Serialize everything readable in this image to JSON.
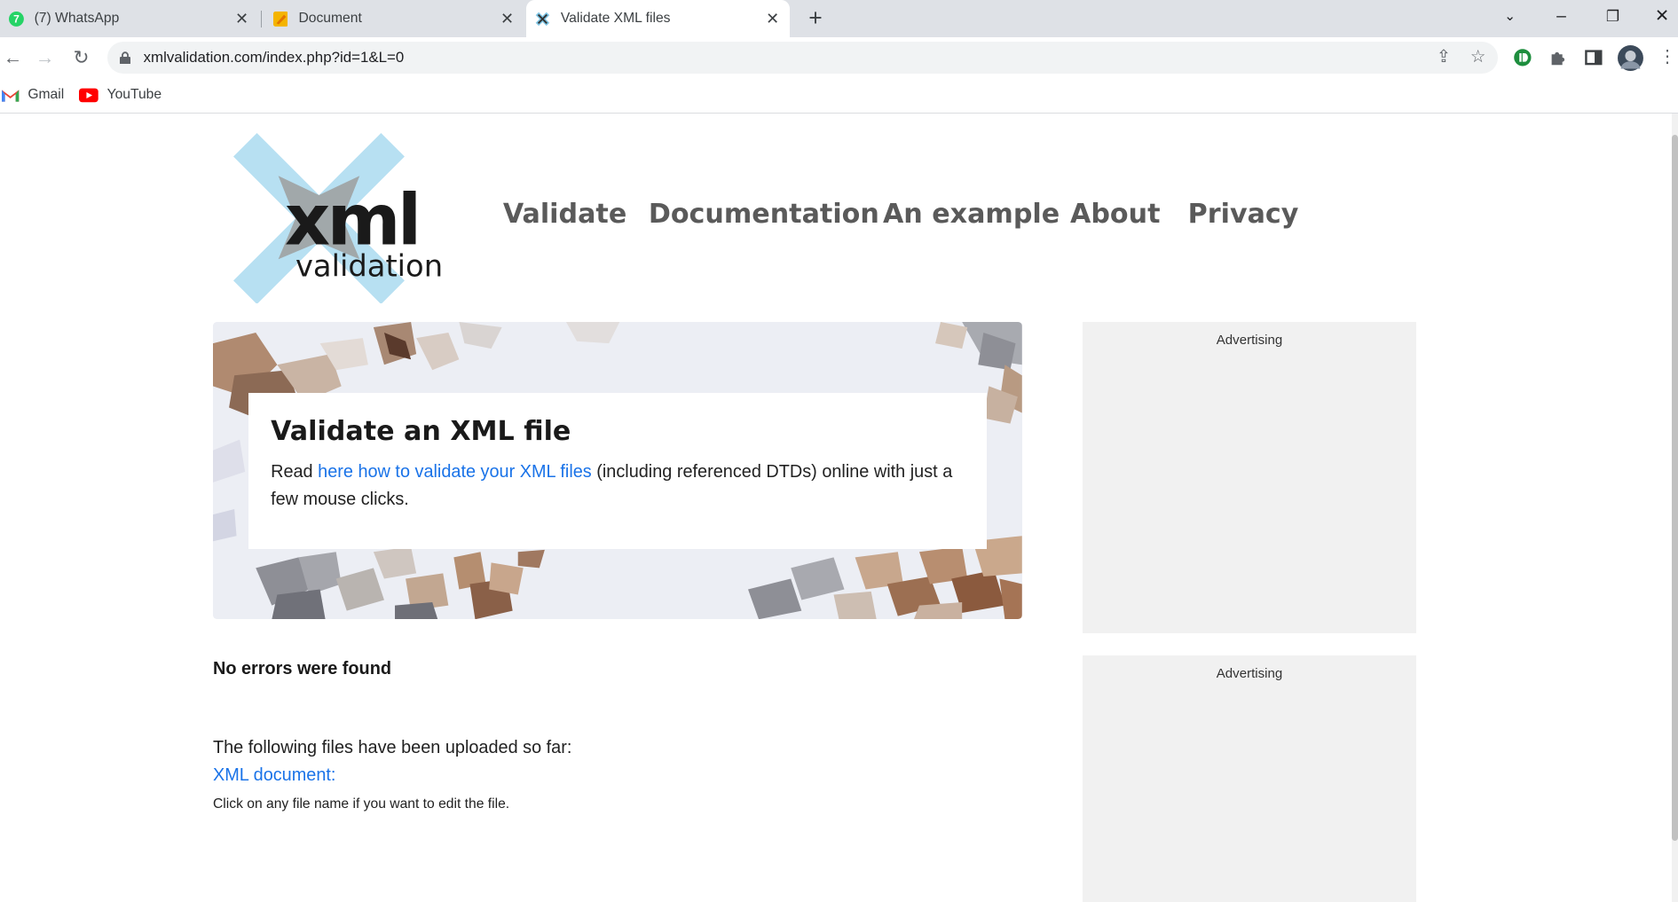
{
  "browser": {
    "tabs": [
      {
        "title": "(7) WhatsApp",
        "icon": "whatsapp-icon"
      },
      {
        "title": "Document",
        "icon": "document-icon"
      },
      {
        "title": "Validate XML files",
        "icon": "xml-validation-icon",
        "active": true
      }
    ],
    "url": "xmlvalidation.com/index.php?id=1&L=0",
    "bookmarks": [
      {
        "label": "Gmail",
        "icon": "gmail-icon"
      },
      {
        "label": "YouTube",
        "icon": "youtube-icon"
      }
    ]
  },
  "site": {
    "logo_text_main": "xml",
    "logo_text_sub": "validation",
    "nav": [
      "Validate",
      "Documentation",
      "An example",
      "About",
      "Privacy"
    ]
  },
  "hero": {
    "title": "Validate an XML file",
    "intro_prefix": "Read ",
    "intro_link": "here how to validate your XML files",
    "intro_suffix": " (including referenced DTDs) online with just a few mouse clicks."
  },
  "result": {
    "status": "No errors were found",
    "uploaded_label": "The following files have been uploaded so far:",
    "file_link": "XML document:",
    "hint": "Click on any file name if you want to edit the file."
  },
  "ads": [
    "Advertising",
    "Advertising"
  ],
  "colors": {
    "link": "#1a73e8",
    "nav_text": "#5a5a5a",
    "logo_cross": "#b7e0f2",
    "logo_cross_overlap": "#9e9e9e",
    "ad_background": "#f1f1f1"
  }
}
